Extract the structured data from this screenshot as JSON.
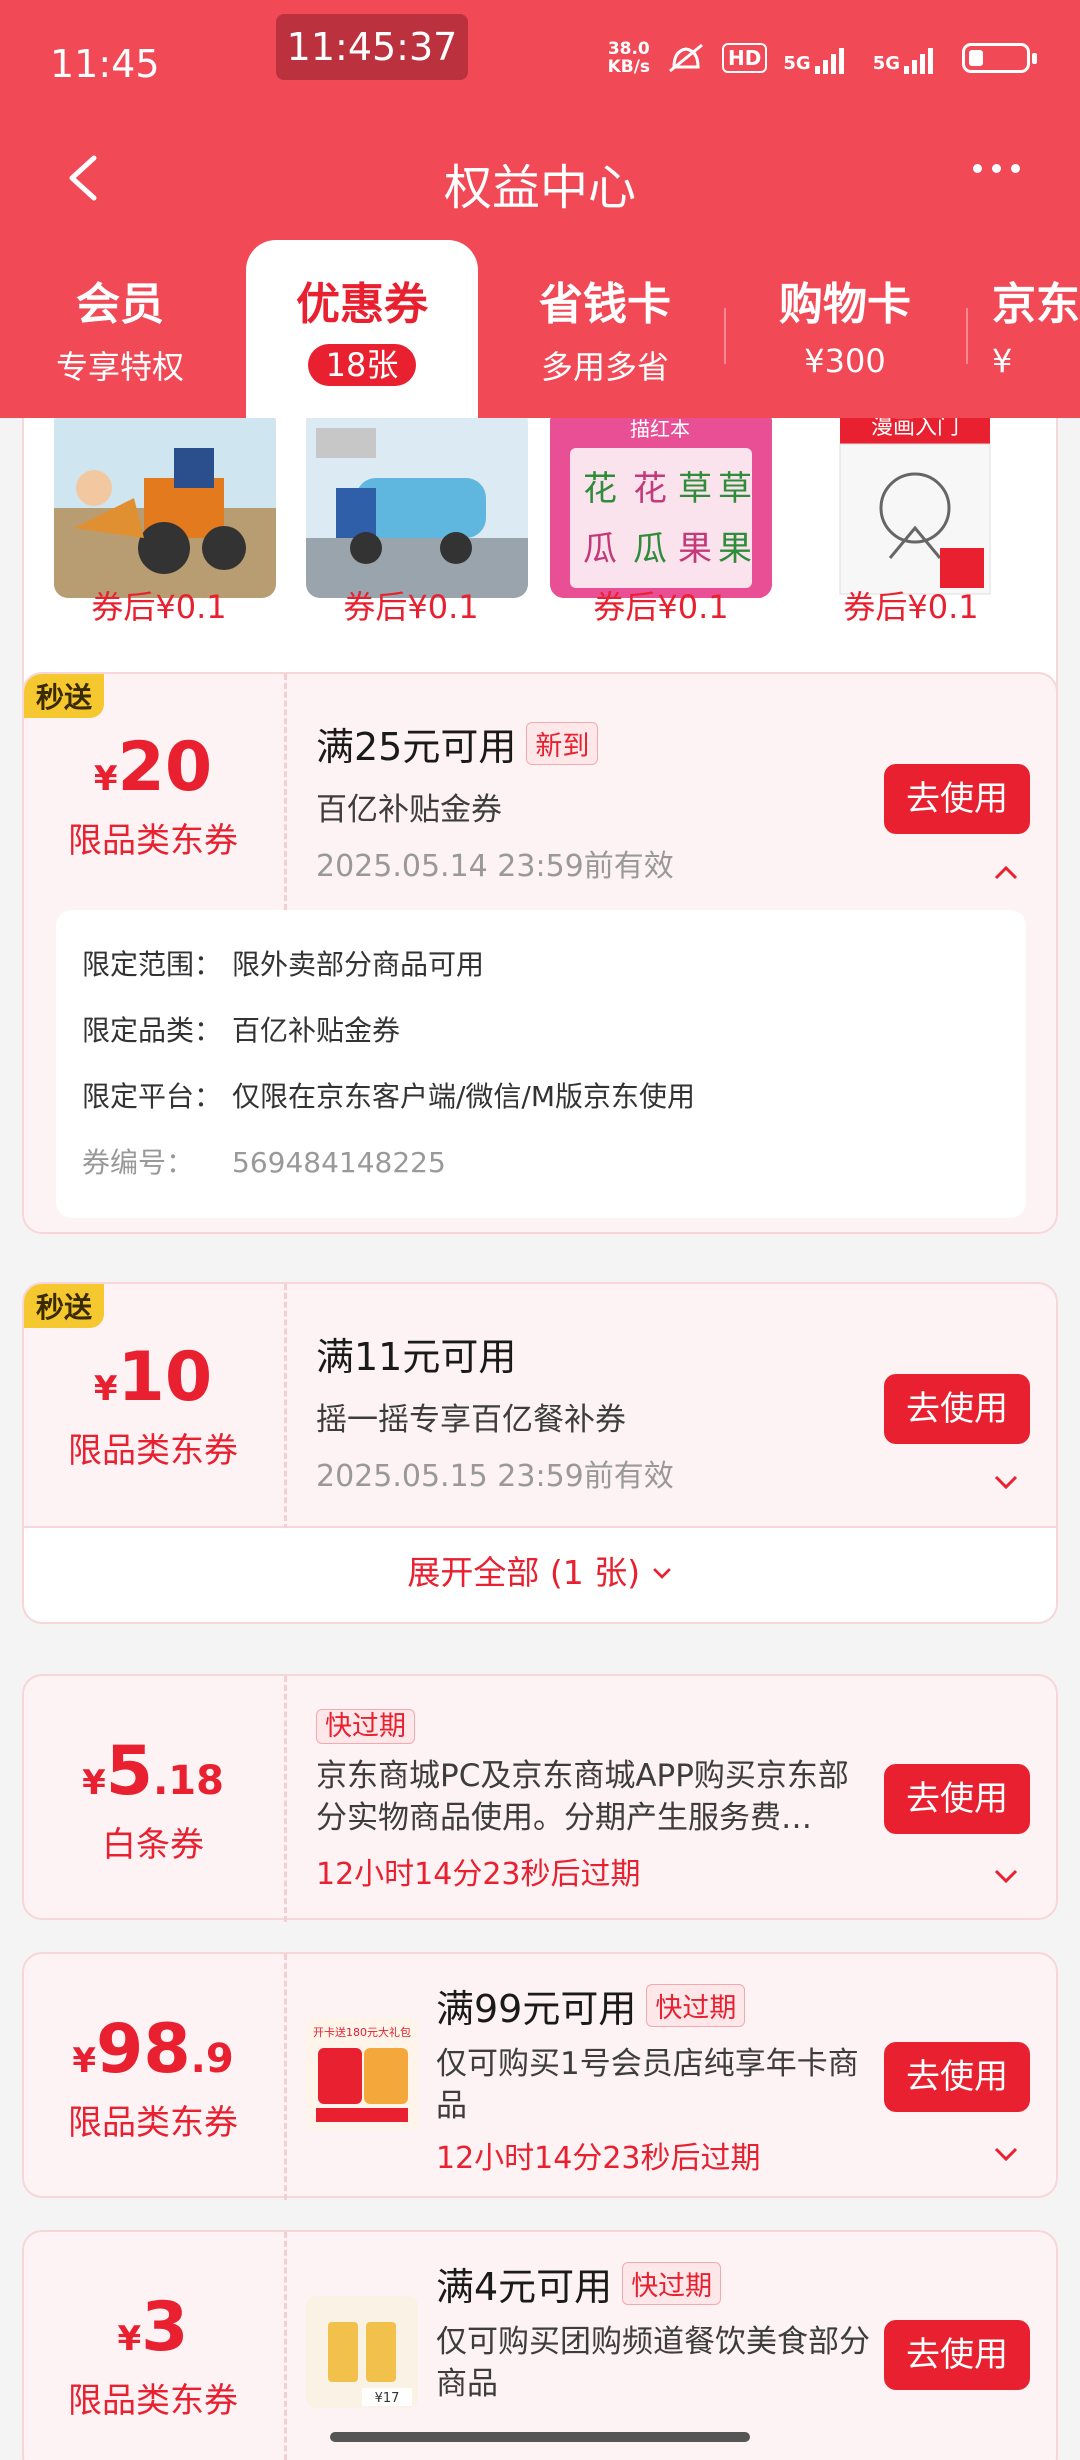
{
  "status": {
    "time": "11:45",
    "clock": "11:45:37",
    "speed_value": "38.0",
    "speed_unit": "KB/s",
    "hd": "HD",
    "net1": "5G",
    "net2": "5G"
  },
  "nav": {
    "title": "权益中心"
  },
  "tabs": [
    {
      "label": "会员",
      "sub": "专享特权"
    },
    {
      "label": "优惠券",
      "sub": "18张"
    },
    {
      "label": "省钱卡",
      "sub": "多用多省"
    },
    {
      "label": "购物卡",
      "sub": "¥300"
    },
    {
      "label": "京东",
      "sub": "¥"
    }
  ],
  "products": [
    {
      "price": "券后¥0.1"
    },
    {
      "price": "券后¥0.1"
    },
    {
      "price": "券后¥0.1"
    },
    {
      "price": "券后¥0.1"
    }
  ],
  "product_cover_text": {
    "p3_title": "描红本",
    "p3_chars": [
      "花",
      "花",
      "草",
      "草",
      "瓜",
      "瓜",
      "果",
      "果"
    ],
    "p4_title": "漫画入门"
  },
  "coupons": [
    {
      "tag": "秒送",
      "currency": "¥",
      "amount": "20",
      "type": "限品类东券",
      "condition": "满25元可用",
      "badge": "新到",
      "desc": "百亿补贴金券",
      "date": "2025.05.14 23:59前有效",
      "button": "去使用",
      "detail": {
        "scope_label": "限定范围：",
        "scope": "限外卖部分商品可用",
        "category_label": "限定品类：",
        "category": "百亿补贴金券",
        "platform_label": "限定平台：",
        "platform": "仅限在京东客户端/微信/M版京东使用",
        "no_label": "券编号：",
        "no": "569484148225"
      }
    },
    {
      "tag": "秒送",
      "currency": "¥",
      "amount": "10",
      "type": "限品类东券",
      "condition": "满11元可用",
      "desc": "摇一摇专享百亿餐补券",
      "date": "2025.05.15 23:59前有效",
      "button": "去使用",
      "expand": "展开全部 (1 张)"
    },
    {
      "currency": "¥",
      "amount": "5",
      "decimal": ".18",
      "type": "白条券",
      "badge": "快过期",
      "desc": "京东商城PC及京东商城APP购买京东部分实物商品使用。分期产生服务费…",
      "expire": "12小时14分23秒后过期",
      "button": "去使用"
    },
    {
      "currency": "¥",
      "amount": "98",
      "decimal": ".9",
      "type": "限品类东券",
      "condition": "满99元可用",
      "badge": "快过期",
      "desc": "仅可购买1号会员店纯享年卡商品",
      "expire": "12小时14分23秒后过期",
      "button": "去使用",
      "thumb_text": "开卡送180元大礼包"
    },
    {
      "currency": "¥",
      "amount": "3",
      "type": "限品类东券",
      "condition": "满4元可用",
      "badge": "快过期",
      "desc": "仅可购买团购频道餐饮美食部分商品",
      "button": "去使用",
      "thumb_text": "¥17"
    }
  ],
  "colors": {
    "brand": "#f24957",
    "accent": "#e8202f",
    "tag": "#f6c82f"
  }
}
